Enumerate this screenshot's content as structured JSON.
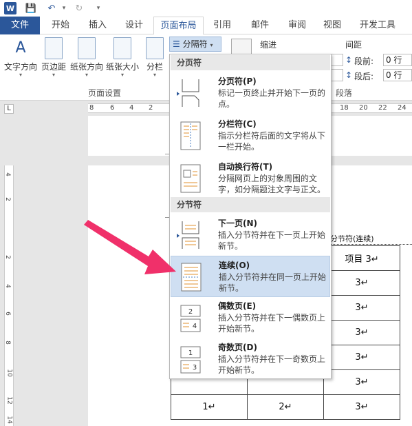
{
  "titlebar": {
    "logo": "W",
    "save": "💾",
    "undo": "↶",
    "undo_drop": "▾",
    "redo": "↻",
    "customize": "▾"
  },
  "tabs": [
    "文件",
    "开始",
    "插入",
    "设计",
    "页面布局",
    "引用",
    "邮件",
    "审阅",
    "视图",
    "开发工具"
  ],
  "ribbon": {
    "text_direction": "文字方向",
    "margins": "页边距",
    "orientation": "纸张方向",
    "size": "纸张大小",
    "columns": "分栏",
    "breaks": "分隔符",
    "indent_label": "缩进",
    "spacing_label": "间距",
    "before_label": "段前:",
    "before_value": "0 行",
    "after_label": "段后:",
    "after_value": "0 行",
    "group_page_setup": "页面设置",
    "group_paragraph": "段落"
  },
  "ruler_h": [
    "8",
    "6",
    "4",
    "2",
    "2",
    "18",
    "20",
    "22",
    "24"
  ],
  "ruler_v": [
    "4",
    "2",
    "2",
    "4",
    "6",
    "8",
    "10",
    "12",
    "14"
  ],
  "menu": {
    "section_page": "分页符",
    "section_section": "分节符",
    "items": [
      {
        "title": "分页符(P)",
        "desc": "标记一页终止并开始下一页的点。"
      },
      {
        "title": "分栏符(C)",
        "desc": "指示分栏符后面的文字将从下一栏开始。"
      },
      {
        "title": "自动换行符(T)",
        "desc": "分隔网页上的对象周围的文字，如分隔题注文字与正文。"
      },
      {
        "title": "下一页(N)",
        "desc": "插入分节符并在下一页上开始新节。"
      },
      {
        "title": "连续(O)",
        "desc": "插入分节符并在同一页上开始新节。"
      },
      {
        "title": "偶数页(E)",
        "desc": "插入分节符并在下一偶数页上开始新节。"
      },
      {
        "title": "奇数页(D)",
        "desc": "插入分节符并在下一奇数页上开始新节。"
      }
    ]
  },
  "document": {
    "section_break": "分节符(连续)",
    "header_cell": "项目 3↵",
    "rows": [
      [
        "",
        "",
        "3↵"
      ],
      [
        "",
        "",
        "3↵"
      ],
      [
        "",
        "",
        "3↵"
      ],
      [
        "",
        "",
        "3↵"
      ],
      [
        "",
        "",
        "3↵"
      ],
      [
        "1↵",
        "2↵",
        "3↵"
      ]
    ]
  },
  "colors": {
    "accent": "#2b579a",
    "highlight": "#cfdff2",
    "arrow": "#f0306a"
  }
}
